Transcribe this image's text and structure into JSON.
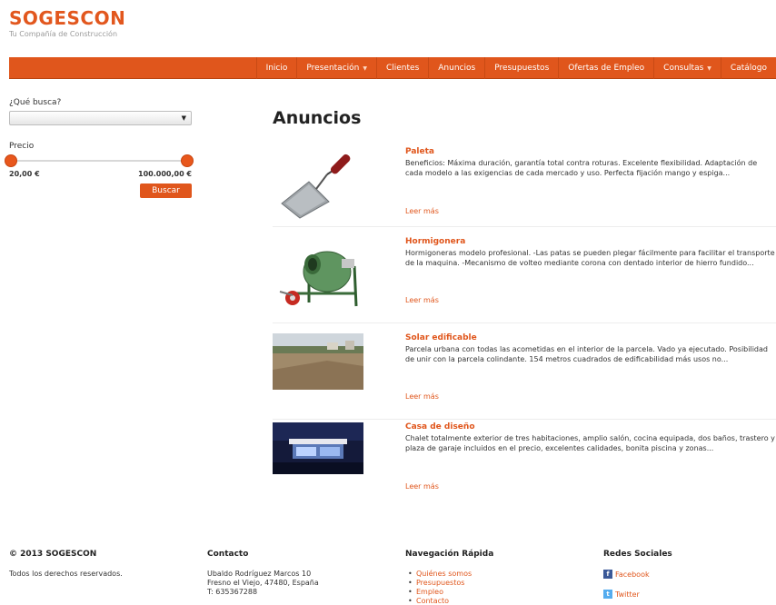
{
  "brand": {
    "name": "SOGESCON",
    "tagline": "Tu Compañía de Construcción"
  },
  "nav": {
    "items": [
      {
        "label": "Inicio",
        "dropdown": false
      },
      {
        "label": "Presentación",
        "dropdown": true
      },
      {
        "label": "Clientes",
        "dropdown": false
      },
      {
        "label": "Anuncios",
        "dropdown": false
      },
      {
        "label": "Presupuestos",
        "dropdown": false
      },
      {
        "label": "Ofertas de Empleo",
        "dropdown": false
      },
      {
        "label": "Consultas",
        "dropdown": true
      },
      {
        "label": "Catálogo",
        "dropdown": false
      }
    ]
  },
  "sidebar": {
    "search_label": "¿Qué busca?",
    "select_value": "",
    "price_label": "Precio",
    "price_min": "20,00 €",
    "price_max": "100.000,00 €",
    "search_button": "Buscar"
  },
  "main": {
    "title": "Anuncios",
    "read_more": "Leer más",
    "listings": [
      {
        "title": "Paleta",
        "description": "Beneficios: Máxima duración, garantía total contra roturas. Excelente flexibilidad. Adaptación de cada modelo a las exigencias de cada mercado y uso. Perfecta fijación mango y espiga..."
      },
      {
        "title": "Hormigonera",
        "description": "Hormigoneras modelo profesional. -Las patas se pueden plegar fácilmente para facilitar el transporte de la maquina. -Mecanismo de volteo mediante corona con dentado interior de hierro fundido..."
      },
      {
        "title": "Solar edificable",
        "description": "Parcela urbana con todas las acometidas en el interior de la parcela. Vado ya ejecutado. Posibilidad de unir con la parcela colindante. 154 metros cuadrados de edificabilidad más usos no..."
      },
      {
        "title": "Casa de diseño",
        "description": "Chalet totalmente exterior de tres habitaciones, amplio salón, cocina equipada, dos baños, trastero y plaza de garaje incluidos en el precio, excelentes calidades, bonita piscina y zonas..."
      }
    ]
  },
  "footer": {
    "copyright_title": "© 2013 SOGESCON",
    "copyright_text": "Todos los derechos reservados.",
    "contact_title": "Contacto",
    "contact_lines": [
      "Ubaldo Rodríguez Marcos 10",
      "Fresno el Viejo, 47480, España",
      "T: 635367288"
    ],
    "nav_title": "Navegación Rápida",
    "nav_links": [
      "Quiénes somos",
      "Presupuestos",
      "Empleo",
      "Contacto"
    ],
    "social_title": "Redes Sociales",
    "social_links": [
      {
        "label": "Facebook",
        "icon": "facebook-icon"
      },
      {
        "label": "Twitter",
        "icon": "twitter-icon"
      }
    ]
  },
  "colors": {
    "accent": "#e0561c",
    "nav_bg": "#e0561c",
    "text": "#333333"
  }
}
